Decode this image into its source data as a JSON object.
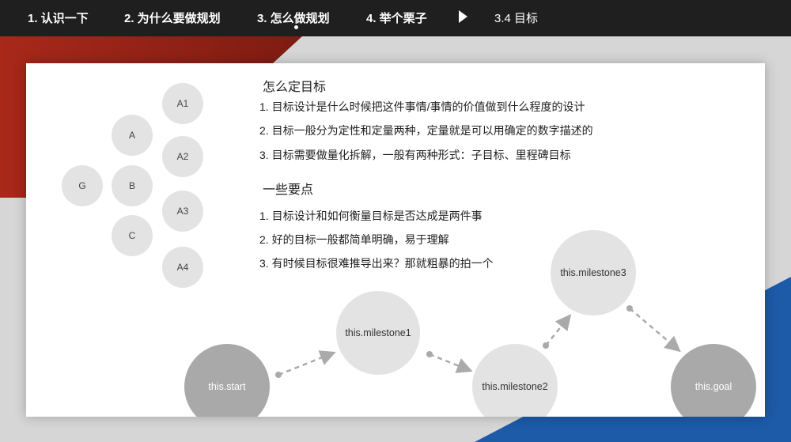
{
  "nav": {
    "items": [
      "1. 认识一下",
      "2. 为什么要做规划",
      "3. 怎么做规划",
      "4. 举个栗子"
    ],
    "current": "3.4 目标"
  },
  "tree": {
    "nodes": [
      "A1",
      "A",
      "A2",
      "G",
      "B",
      "A3",
      "C",
      "A4"
    ]
  },
  "section1": {
    "title": "怎么定目标",
    "items": [
      "1.  目标设计是什么时候把这件事情/事情的价值做到什么程度的设计",
      "2.  目标一般分为定性和定量两种，定量就是可以用确定的数字描述的",
      "3.  目标需要做量化拆解，一般有两种形式：子目标、里程碑目标"
    ]
  },
  "section2": {
    "title": "一些要点",
    "items": [
      "1.  目标设计和如何衡量目标是否达成是两件事",
      "2.  好的目标一般都简单明确，易于理解",
      "3.  有时候目标很难推导出来？那就粗暴的拍一个"
    ]
  },
  "flow": {
    "start": "this.start",
    "m1": "this.milestone1",
    "m2": "this.milestone2",
    "m3": "this.milestone3",
    "goal": "this.goal"
  },
  "colors": {
    "red": "#9e2416",
    "blue": "#1d5aa8",
    "bar": "#1f1f20"
  }
}
